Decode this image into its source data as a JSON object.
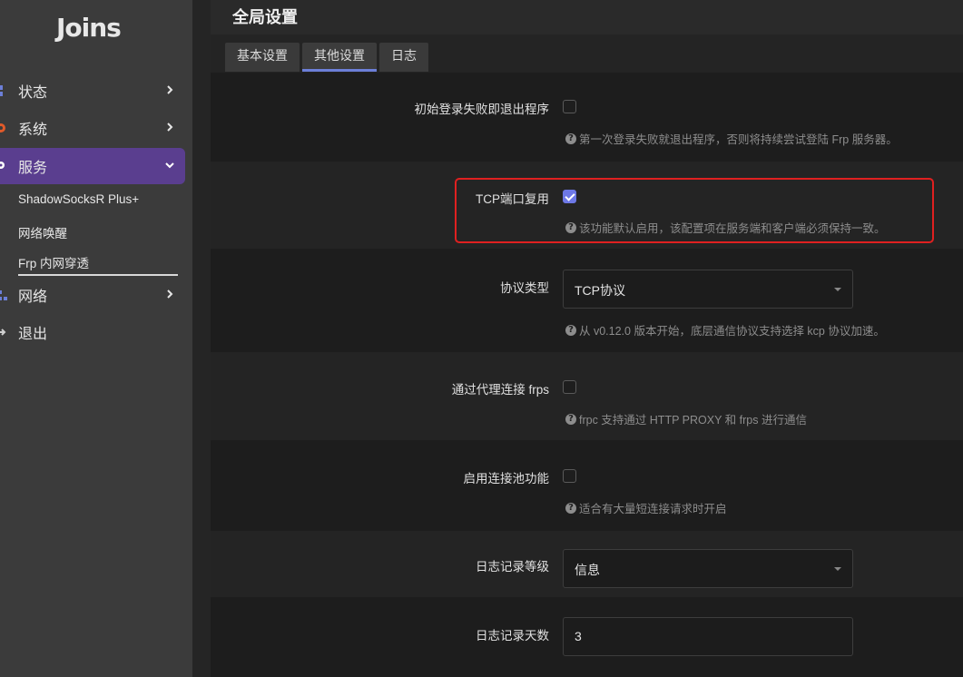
{
  "logo": "Joins",
  "sidebar": {
    "items": [
      {
        "label": "状态"
      },
      {
        "label": "系统"
      },
      {
        "label": "服务"
      },
      {
        "label": "网络"
      },
      {
        "label": "退出"
      }
    ],
    "sub_items": [
      {
        "label": "ShadowSocksR Plus+"
      },
      {
        "label": "网络唤醒"
      },
      {
        "label": "Frp 内网穿透"
      }
    ]
  },
  "header": {
    "title": "全局设置"
  },
  "tabs": [
    {
      "label": "基本设置"
    },
    {
      "label": "其他设置"
    },
    {
      "label": "日志"
    }
  ],
  "fields": {
    "exit_on_fail": {
      "label": "初始登录失败即退出程序",
      "checked": false,
      "hint": "第一次登录失败就退出程序，否则将持续尝试登陆 Frp 服务器。"
    },
    "tcp_mux": {
      "label": "TCP端口复用",
      "checked": true,
      "hint": "该功能默认启用，该配置项在服务端和客户端必须保持一致。"
    },
    "protocol": {
      "label": "协议类型",
      "value": "TCP协议",
      "hint": "从 v0.12.0 版本开始，底层通信协议支持选择 kcp 协议加速。"
    },
    "proxy": {
      "label": "通过代理连接 frps",
      "checked": false,
      "hint": "frpc 支持通过 HTTP PROXY 和 frps 进行通信"
    },
    "pool": {
      "label": "启用连接池功能",
      "checked": false,
      "hint": "适合有大量短连接请求时开启"
    },
    "log_level": {
      "label": "日志记录等级",
      "value": "信息"
    },
    "log_days": {
      "label": "日志记录天数",
      "value": "3"
    }
  },
  "colors": {
    "accent": "#6d78e6",
    "active_nav": "#5a3e8f",
    "highlight": "#e02020"
  }
}
